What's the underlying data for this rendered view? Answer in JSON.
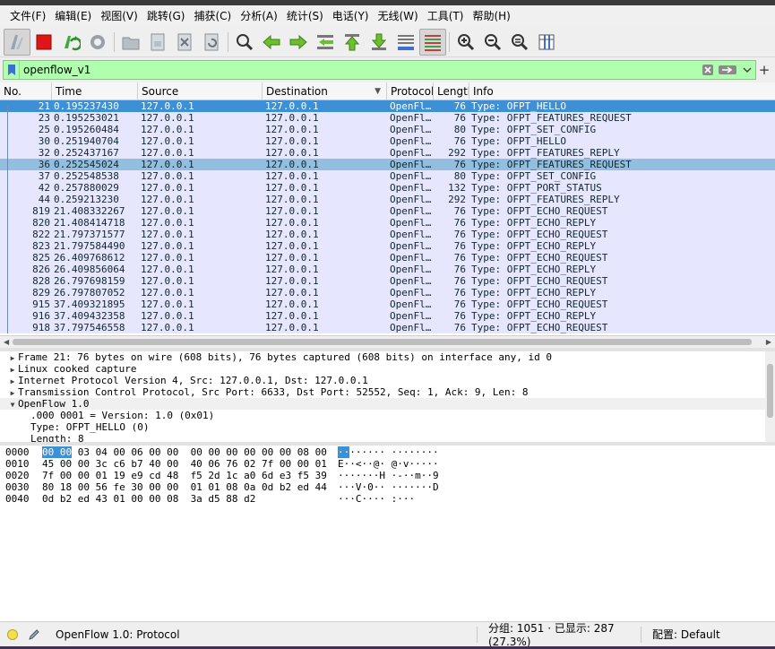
{
  "menu": [
    "文件(F)",
    "编辑(E)",
    "视图(V)",
    "跳转(G)",
    "捕获(C)",
    "分析(A)",
    "统计(S)",
    "电话(Y)",
    "无线(W)",
    "工具(T)",
    "帮助(H)"
  ],
  "filter": {
    "value": "openflow_v1"
  },
  "columns": {
    "no": "No.",
    "time": "Time",
    "source": "Source",
    "destination": "Destination",
    "protocol": "Protocol",
    "length": "Length",
    "info": "Info"
  },
  "packets": [
    {
      "no": "21",
      "time": "0.195237430",
      "src": "127.0.0.1",
      "dst": "127.0.0.1",
      "proto": "OpenFl…",
      "len": "76",
      "info": "Type: OFPT_HELLO",
      "state": "selected"
    },
    {
      "no": "23",
      "time": "0.195253021",
      "src": "127.0.0.1",
      "dst": "127.0.0.1",
      "proto": "OpenFl…",
      "len": "76",
      "info": "Type: OFPT_FEATURES_REQUEST",
      "state": ""
    },
    {
      "no": "25",
      "time": "0.195260484",
      "src": "127.0.0.1",
      "dst": "127.0.0.1",
      "proto": "OpenFl…",
      "len": "80",
      "info": "Type: OFPT_SET_CONFIG",
      "state": ""
    },
    {
      "no": "30",
      "time": "0.251940704",
      "src": "127.0.0.1",
      "dst": "127.0.0.1",
      "proto": "OpenFl…",
      "len": "76",
      "info": "Type: OFPT_HELLO",
      "state": ""
    },
    {
      "no": "32",
      "time": "0.252437167",
      "src": "127.0.0.1",
      "dst": "127.0.0.1",
      "proto": "OpenFl…",
      "len": "292",
      "info": "Type: OFPT_FEATURES_REPLY",
      "state": ""
    },
    {
      "no": "36",
      "time": "0.252545024",
      "src": "127.0.0.1",
      "dst": "127.0.0.1",
      "proto": "OpenFl…",
      "len": "76",
      "info": "Type: OFPT_FEATURES_REQUEST",
      "state": "marked"
    },
    {
      "no": "37",
      "time": "0.252548538",
      "src": "127.0.0.1",
      "dst": "127.0.0.1",
      "proto": "OpenFl…",
      "len": "80",
      "info": "Type: OFPT_SET_CONFIG",
      "state": ""
    },
    {
      "no": "42",
      "time": "0.257880029",
      "src": "127.0.0.1",
      "dst": "127.0.0.1",
      "proto": "OpenFl…",
      "len": "132",
      "info": "Type: OFPT_PORT_STATUS",
      "state": ""
    },
    {
      "no": "44",
      "time": "0.259213230",
      "src": "127.0.0.1",
      "dst": "127.0.0.1",
      "proto": "OpenFl…",
      "len": "292",
      "info": "Type: OFPT_FEATURES_REPLY",
      "state": ""
    },
    {
      "no": "819",
      "time": "21.408332267",
      "src": "127.0.0.1",
      "dst": "127.0.0.1",
      "proto": "OpenFl…",
      "len": "76",
      "info": "Type: OFPT_ECHO_REQUEST",
      "state": ""
    },
    {
      "no": "820",
      "time": "21.408414718",
      "src": "127.0.0.1",
      "dst": "127.0.0.1",
      "proto": "OpenFl…",
      "len": "76",
      "info": "Type: OFPT_ECHO_REPLY",
      "state": ""
    },
    {
      "no": "822",
      "time": "21.797371577",
      "src": "127.0.0.1",
      "dst": "127.0.0.1",
      "proto": "OpenFl…",
      "len": "76",
      "info": "Type: OFPT_ECHO_REQUEST",
      "state": ""
    },
    {
      "no": "823",
      "time": "21.797584490",
      "src": "127.0.0.1",
      "dst": "127.0.0.1",
      "proto": "OpenFl…",
      "len": "76",
      "info": "Type: OFPT_ECHO_REPLY",
      "state": ""
    },
    {
      "no": "825",
      "time": "26.409768612",
      "src": "127.0.0.1",
      "dst": "127.0.0.1",
      "proto": "OpenFl…",
      "len": "76",
      "info": "Type: OFPT_ECHO_REQUEST",
      "state": ""
    },
    {
      "no": "826",
      "time": "26.409856064",
      "src": "127.0.0.1",
      "dst": "127.0.0.1",
      "proto": "OpenFl…",
      "len": "76",
      "info": "Type: OFPT_ECHO_REPLY",
      "state": ""
    },
    {
      "no": "828",
      "time": "26.797698159",
      "src": "127.0.0.1",
      "dst": "127.0.0.1",
      "proto": "OpenFl…",
      "len": "76",
      "info": "Type: OFPT_ECHO_REQUEST",
      "state": ""
    },
    {
      "no": "829",
      "time": "26.797807052",
      "src": "127.0.0.1",
      "dst": "127.0.0.1",
      "proto": "OpenFl…",
      "len": "76",
      "info": "Type: OFPT_ECHO_REPLY",
      "state": ""
    },
    {
      "no": "915",
      "time": "37.409321895",
      "src": "127.0.0.1",
      "dst": "127.0.0.1",
      "proto": "OpenFl…",
      "len": "76",
      "info": "Type: OFPT_ECHO_REQUEST",
      "state": ""
    },
    {
      "no": "916",
      "time": "37.409432358",
      "src": "127.0.0.1",
      "dst": "127.0.0.1",
      "proto": "OpenFl…",
      "len": "76",
      "info": "Type: OFPT_ECHO_REPLY",
      "state": ""
    },
    {
      "no": "918",
      "time": "37.797546558",
      "src": "127.0.0.1",
      "dst": "127.0.0.1",
      "proto": "OpenFl…",
      "len": "76",
      "info": "Type: OFPT_ECHO_REQUEST",
      "state": ""
    }
  ],
  "details": [
    {
      "text": "Frame 21: 76 bytes on wire (608 bits), 76 bytes captured (608 bits) on interface any, id 0",
      "twisty": "right",
      "indent": 0
    },
    {
      "text": "Linux cooked capture",
      "twisty": "right",
      "indent": 0
    },
    {
      "text": "Internet Protocol Version 4, Src: 127.0.0.1, Dst: 127.0.0.1",
      "twisty": "right",
      "indent": 0
    },
    {
      "text": "Transmission Control Protocol, Src Port: 6633, Dst Port: 52552, Seq: 1, Ack: 9, Len: 8",
      "twisty": "right",
      "indent": 0
    },
    {
      "text": "OpenFlow 1.0",
      "twisty": "down",
      "indent": 0
    },
    {
      "text": ".000 0001 = Version: 1.0 (0x01)",
      "twisty": "",
      "indent": 1
    },
    {
      "text": "Type: OFPT_HELLO (0)",
      "twisty": "",
      "indent": 1
    },
    {
      "text": "Length: 8",
      "twisty": "",
      "indent": 1
    }
  ],
  "bytes": [
    {
      "off": "0000",
      "hexHl": "00 00",
      "hex": " 03 04 00 06 00 00  00 00 00 00 00 00 08 00",
      "ascHl": "··",
      "asc": "······ ········"
    },
    {
      "off": "0010",
      "hexHl": "",
      "hex": "45 00 00 3c c6 b7 40 00  40 06 76 02 7f 00 00 01",
      "ascHl": "",
      "asc": "E··<··@· @·v·····"
    },
    {
      "off": "0020",
      "hexHl": "",
      "hex": "7f 00 00 01 19 e9 cd 48  f5 2d 1c a0 6d e3 f5 39",
      "ascHl": "",
      "asc": "·······H ·-··m··9"
    },
    {
      "off": "0030",
      "hexHl": "",
      "hex": "80 18 00 56 fe 30 00 00  01 01 08 0a 0d b2 ed 44",
      "ascHl": "",
      "asc": "···V·0·· ·······D"
    },
    {
      "off": "0040",
      "hexHl": "",
      "hex": "0d b2 ed 43 01 00 00 08  3a d5 88 d2",
      "ascHl": "",
      "asc": "···C···· :···"
    }
  ],
  "status": {
    "text": "OpenFlow 1.0: Protocol",
    "packets": "分组: 1051 · 已显示: 287 (27.3%)",
    "profile": "配置: Default"
  }
}
